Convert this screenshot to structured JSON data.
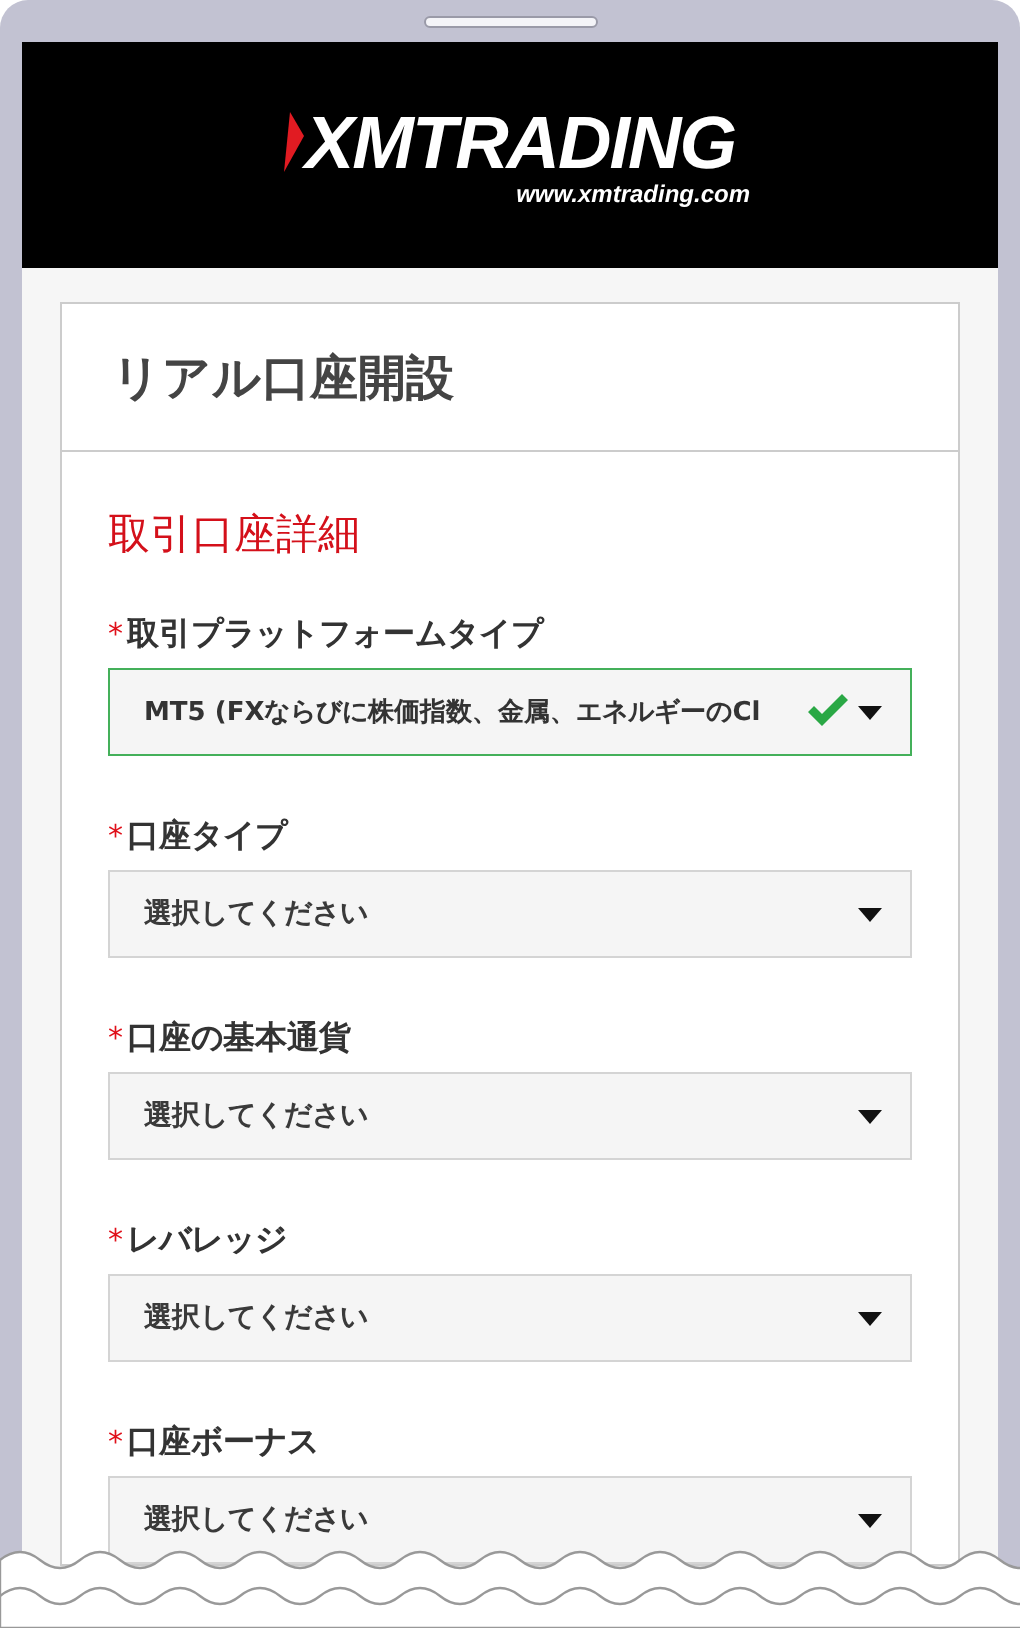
{
  "header": {
    "logo_text": "XMTRADING",
    "url": "www.xmtrading.com"
  },
  "page_title": "リアル口座開設",
  "section_title": "取引口座詳細",
  "fields": [
    {
      "label": "取引プラットフォームタイプ",
      "required_mark": "*",
      "value": "MT5 (FXならびに株価指数、金属、エネルギーのCl",
      "valid": true
    },
    {
      "label": "口座タイプ",
      "required_mark": "*",
      "placeholder": "選択してください",
      "valid": false
    },
    {
      "label": "口座の基本通貨",
      "required_mark": "*",
      "placeholder": "選択してください",
      "valid": false
    },
    {
      "label": "レバレッジ",
      "required_mark": "*",
      "placeholder": "選択してください",
      "valid": false
    },
    {
      "label": "口座ボーナス",
      "required_mark": "*",
      "placeholder": "選択してください",
      "valid": false
    }
  ]
}
